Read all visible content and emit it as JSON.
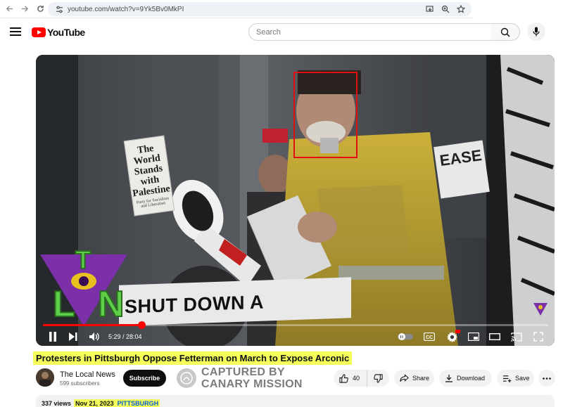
{
  "browser": {
    "url": "youtube.com/watch?v=9Yk5Bv0MkPI"
  },
  "masthead": {
    "logo_text": "YouTube",
    "search_placeholder": "Search"
  },
  "video": {
    "current_time": "5:29",
    "duration": "28:04",
    "progress_fraction": 0.195,
    "time_display": "5:29 / 28:04",
    "sign_text": [
      "The",
      "World",
      "Stands",
      "with",
      "Palestine"
    ],
    "sign_small_text": "Party for Socialism and Liberation",
    "banner_text": "SHUT DOWN A",
    "right_banner_text": "EASE",
    "overlay_logo_letters": "LTN"
  },
  "title": "Protesters in Pittsburgh Oppose Fetterman on March to Expose Arconic",
  "channel": {
    "name": "The Local News",
    "subscribers": "599 subscribers",
    "subscribe_label": "Subscribe"
  },
  "watermark": {
    "line1": "CAPTURED BY",
    "line2": "CANARY MISSION"
  },
  "actions": {
    "likes": "40",
    "share_label": "Share",
    "download_label": "Download",
    "save_label": "Save"
  },
  "description": {
    "views": "337 views",
    "date": "Nov 21, 2023",
    "hashtag": "PITTSBURGH"
  },
  "colors": {
    "accent_red": "#ff0000",
    "highlight": "#f4ff5c",
    "face_box": "#e01010"
  }
}
